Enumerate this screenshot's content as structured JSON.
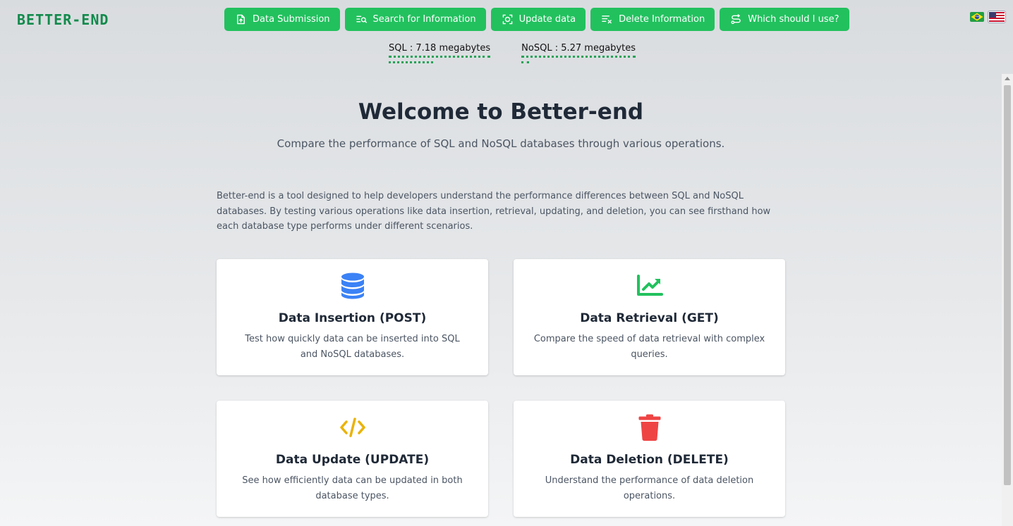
{
  "brand": {
    "logo": "BETTER-END"
  },
  "nav": [
    {
      "label": "Data Submission",
      "icon": "file-upload-icon"
    },
    {
      "label": "Search for Information",
      "icon": "search-list-icon"
    },
    {
      "label": "Update data",
      "icon": "refresh-target-icon"
    },
    {
      "label": "Delete Information",
      "icon": "clear-list-icon"
    },
    {
      "label": "Which should I use?",
      "icon": "route-icon"
    }
  ],
  "flags": [
    {
      "label": "Brazil flag"
    },
    {
      "label": "United States flag"
    }
  ],
  "meters": {
    "sql": {
      "label": "SQL : 7.18 megabytes",
      "fill": 0.44
    },
    "nosql": {
      "label": "NoSQL : 5.27 megabytes",
      "fill": 0.07
    }
  },
  "hero": {
    "title": "Welcome to Better-end",
    "subtitle": "Compare the performance of SQL and NoSQL databases through various operations."
  },
  "intro": "Better-end is a tool designed to help developers understand the performance differences between SQL and NoSQL databases. By testing various operations like data insertion, retrieval, updating, and deletion, you can see firsthand how each database type performs under different scenarios.",
  "cards": [
    {
      "title": "Data Insertion (POST)",
      "description": "Test how quickly data can be inserted into SQL and NoSQL databases.",
      "icon": "database-icon",
      "color": "#3b82f6"
    },
    {
      "title": "Data Retrieval (GET)",
      "description": "Compare the speed of data retrieval with complex queries.",
      "icon": "chart-line-icon",
      "color": "#22c15e"
    },
    {
      "title": "Data Update (UPDATE)",
      "description": "See how efficiently data can be updated in both database types.",
      "icon": "code-icon",
      "color": "#eab308"
    },
    {
      "title": "Data Deletion (DELETE)",
      "description": "Understand the performance of data deletion operations.",
      "icon": "trash-icon",
      "color": "#ef4444"
    }
  ],
  "colors": {
    "accent": "#22c15e",
    "brand": "#128a4c",
    "meter": "#22a357"
  }
}
